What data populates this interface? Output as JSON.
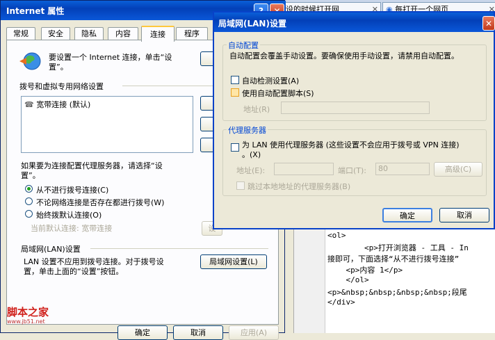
{
  "bg_tabs": [
    {
      "label": "设的时候打开网",
      "close": "✕"
    },
    {
      "label": "每打开一个网页",
      "close": "✕"
    }
  ],
  "code": {
    "lines": [
      "<ol>",
      "        <p>打开浏览器 - 工具 - In",
      "接即可，下面选择“从不进行拨号连接”",
      "    <p>内容 1</p>",
      "    </ol>",
      "<p>&nbsp;&nbsp;&nbsp;&nbsp;段尾",
      "</div>"
    ]
  },
  "inet": {
    "title": "Internet 属性",
    "help": "?",
    "close": "✕",
    "tabs": [
      "常规",
      "安全",
      "隐私",
      "内容",
      "连接",
      "程序"
    ],
    "active_tab": "连接",
    "setup_text_1": "要设置一个 Internet 连接，单击“设",
    "setup_text_2": "置”。",
    "dialup_heading": "拨号和虚拟专用网络设置",
    "connections": [
      "宽带连接 (默认)"
    ],
    "proxy_text_1": "如果要为连接配置代理服务器，请选择“设",
    "proxy_text_2": "置”。",
    "radio_never": "从不进行拨号连接(C)",
    "radio_no_network": "不论网络连接是否存在都进行拨号(W)",
    "radio_always": "始终拨默认连接(O)",
    "current_default": "当前默认连接:   宽带连接",
    "settings_btn": "设",
    "lan_heading": "局域网(LAN)设置",
    "lan_text_1": "LAN 设置不应用到拨号连接。对于拨号设",
    "lan_text_2": "置，单击上面的“设置”按钮。",
    "lan_btn": "局域网设置(L)",
    "ok": "确定",
    "cancel": "取消",
    "apply": "应用(A)"
  },
  "lan": {
    "title": "局域网(LAN)设置",
    "close": "✕",
    "auto_group": "自动配置",
    "auto_desc": "自动配置会覆盖手动设置。要确保使用手动设置，请禁用自动配置。",
    "auto_detect": "自动检测设置(A)",
    "auto_script": "使用自动配置脚本(S)",
    "address_label": "地址(R)",
    "proxy_group": "代理服务器",
    "proxy_use_1": "为 LAN 使用代理服务器 (这些设置不会应用于拨号或 VPN 连接)",
    "proxy_use_2": "。(X)",
    "proxy_addr_label": "地址(E):",
    "port_label": "端口(T):",
    "port_value": "80",
    "advanced_btn": "高级(C)",
    "bypass": "跳过本地地址的代理服务器(B)",
    "ok": "确定",
    "cancel": "取消"
  },
  "watermark": {
    "text": "脚本之家",
    "url": "www.jb51.net"
  },
  "colors": {
    "title_blue": "#0a57d8",
    "legend_blue": "#0046d5",
    "watermark_red": "#d0211c"
  }
}
